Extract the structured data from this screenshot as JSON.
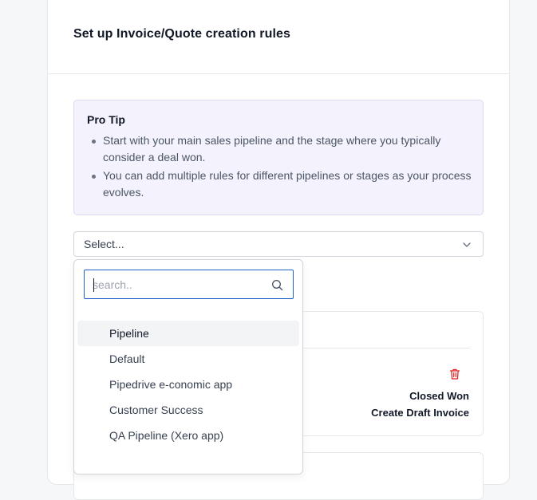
{
  "card": {
    "title": "Set up Invoice/Quote creation rules"
  },
  "tip": {
    "title": "Pro Tip",
    "items": [
      "Start with your main sales pipeline and the stage where you typically consider a deal won.",
      "You can add multiple rules for different pipelines or stages as your process evolves."
    ]
  },
  "select": {
    "value": "Select..."
  },
  "dropdown": {
    "search_placeholder": "search..",
    "options": [
      "Pipeline",
      "Default",
      "Pipedrive e-conomic app",
      "Customer Success",
      "QA Pipeline (Xero app)"
    ]
  },
  "rule": {
    "stage": "Closed Won",
    "action": "Create Draft Invoice"
  },
  "colors": {
    "accent": "#1f63c6",
    "danger": "#e02424",
    "tip_bg": "#f4f3fd"
  },
  "icons": {
    "chevron": "chevron-down-icon",
    "search": "search-icon",
    "trash": "trash-icon"
  }
}
